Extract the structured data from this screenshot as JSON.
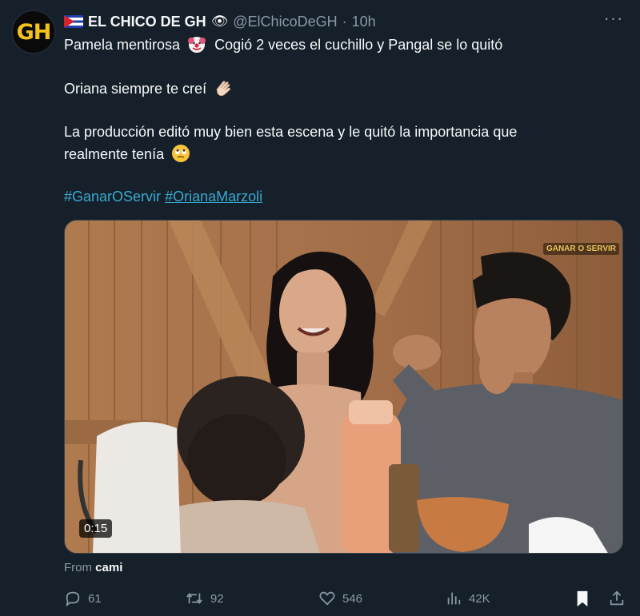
{
  "author": {
    "name": "EL CHICO DE GH",
    "handle": "@ElChicoDeGH",
    "separator": "·",
    "time": "10h",
    "avatar_text": "GH",
    "flag_icon": "cuba-flag-icon",
    "eye_emoji": "👁"
  },
  "tweet": {
    "line1_a": "Pamela mentirosa",
    "line1_emoji": "🤡",
    "line1_b": "Cogió 2 veces el cuchillo y Pangal se lo quitó",
    "line2": "Oriana siempre te creí",
    "line2_emoji": "👏🏻",
    "line3": "La producción editó muy bien esta escena y le quitó la importancia que",
    "line4": "realmente tenía",
    "line4_emoji": "🙄",
    "hashtags": [
      "#GanarOServir",
      "#OrianaMarzoli"
    ]
  },
  "media": {
    "duration": "0:15",
    "overlay_logo": "GANAR O SERVIR"
  },
  "attribution": {
    "prefix": "From",
    "source": "cami"
  },
  "stats": {
    "replies": "61",
    "reposts": "92",
    "likes": "546",
    "views": "42K"
  },
  "colors": {
    "background": "#15202b",
    "text": "#f7f9f9",
    "muted": "#8b98a5",
    "hashtag": "#3aa9cf"
  }
}
